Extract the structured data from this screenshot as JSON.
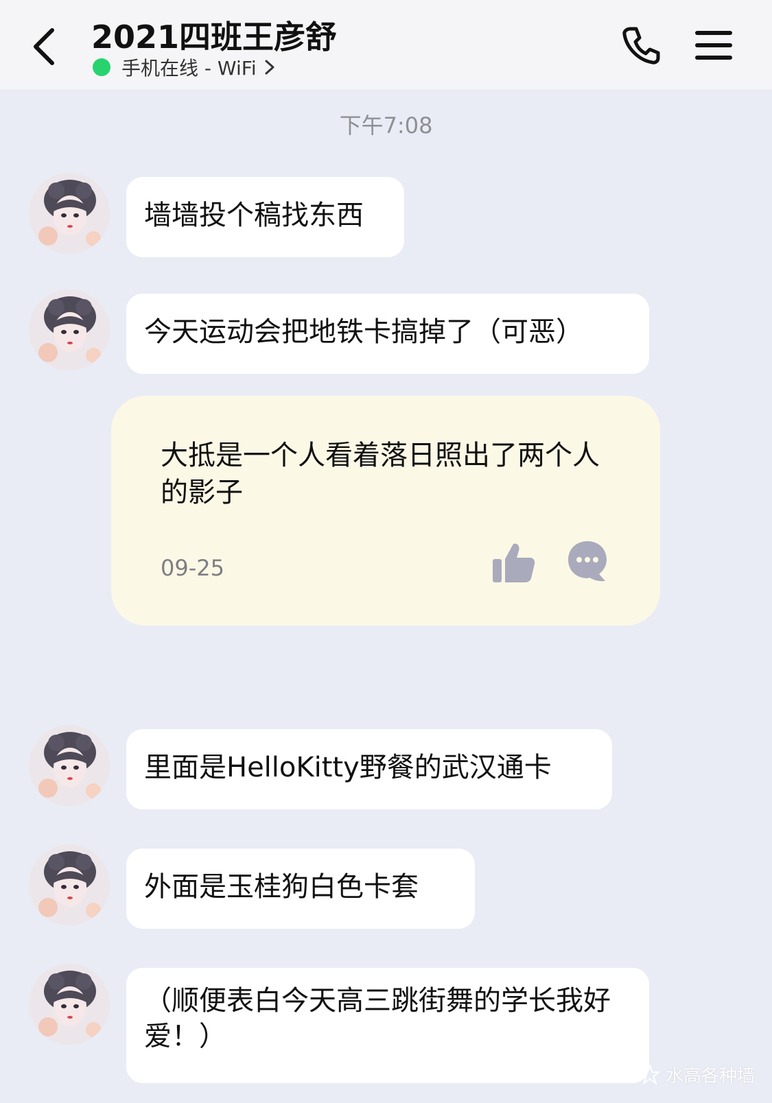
{
  "header": {
    "title": "2021四班王彦舒",
    "status": "手机在线 - WiFi"
  },
  "time_label": "下午7:08",
  "messages": [
    {
      "text": "墙墙投个稿找东西"
    },
    {
      "text": "今天运动会把地铁卡搞掉了（可恶）"
    },
    {
      "text": "里面是HelloKitty野餐的武汉通卡"
    },
    {
      "text": "外面是玉桂狗白色卡套"
    },
    {
      "text": "（顺便表白今天高三跳街舞的学长我好爱！）"
    }
  ],
  "card": {
    "text": "大抵是一个人看着落日照出了两个人的影子",
    "date": "09-25"
  },
  "watermark": "水高各种墙",
  "colors": {
    "background": "#e9ecf5",
    "header": "#f5f5f7",
    "online_dot": "#27d36f",
    "card": "#fcf8e6",
    "icon_gray": "#a9aabb"
  },
  "icons": [
    "back-icon",
    "phone-icon",
    "menu-icon",
    "chevron-right-icon",
    "like-icon",
    "comment-icon"
  ]
}
